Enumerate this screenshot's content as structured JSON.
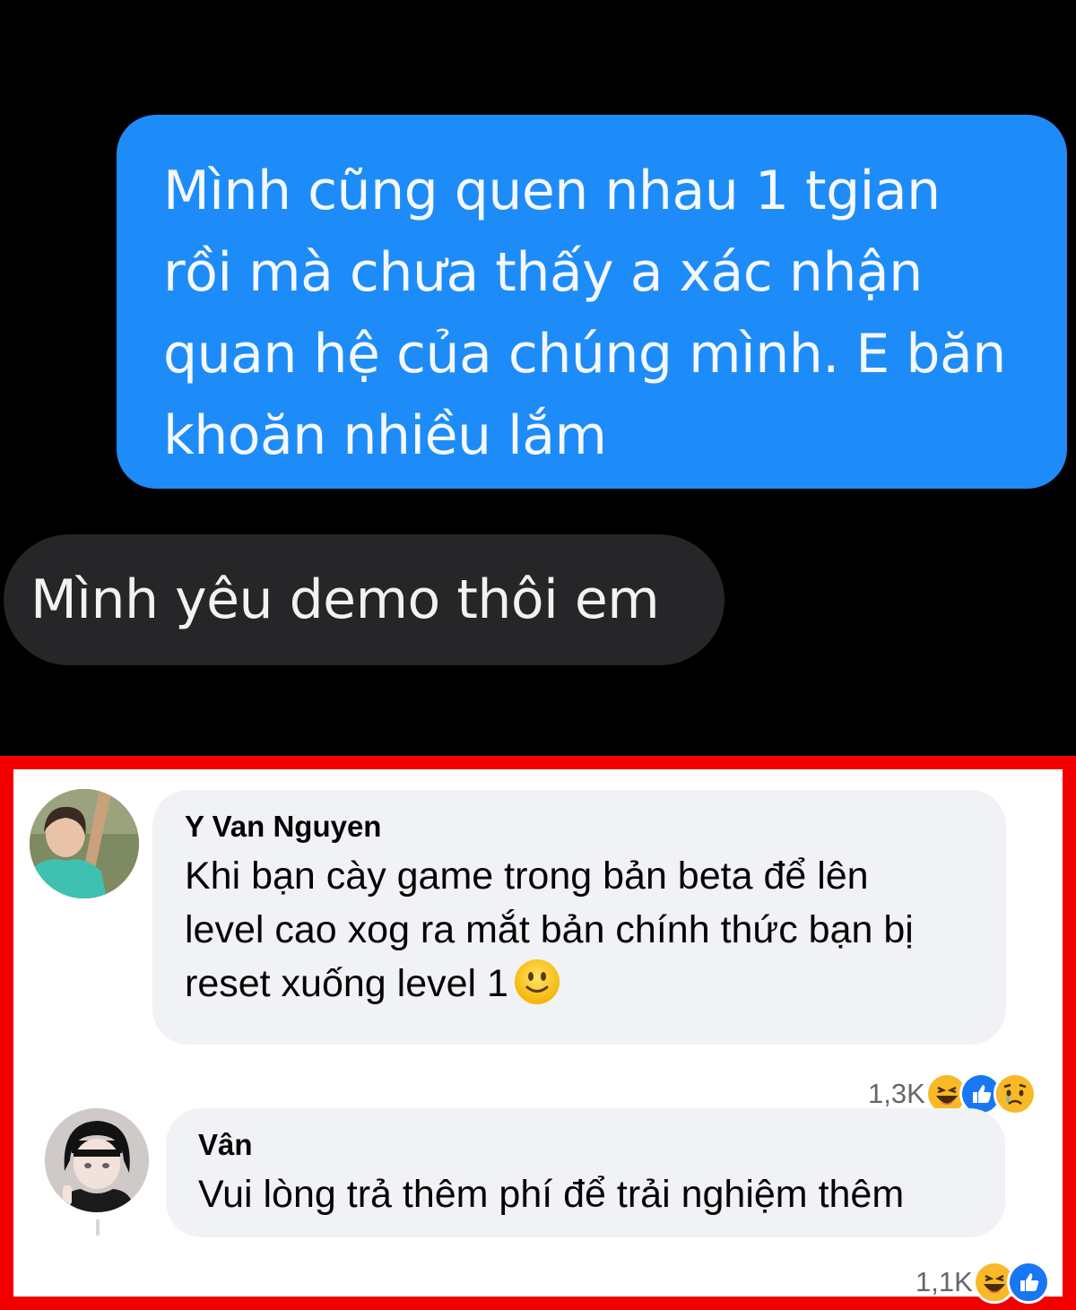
{
  "chat": {
    "sent_message": "Mình cũng quen nhau 1 tgian\nrồi mà chưa thấy a xác nhận\nquan hệ của chúng mình. E băn\nkhoăn nhiều lắm",
    "received_message": "Mình yêu demo thôi em"
  },
  "comments": [
    {
      "author": "Y Van Nguyen",
      "text": "Khi bạn cày game trong bản beta để lên\nlevel cao xog ra mắt bản chính thức bạn bị\nreset xuống level 1",
      "inline_emoji": "slightly-smiling-face",
      "reaction_count": "1,3K",
      "reactions": [
        "laugh",
        "like",
        "sad"
      ]
    },
    {
      "author": "Vân",
      "text": "Vui lòng trả thêm phí để trải nghiệm thêm",
      "reaction_count": "1,1K",
      "reactions": [
        "laugh",
        "like"
      ]
    }
  ],
  "colors": {
    "sent_bubble": "#1d8cf8",
    "received_bubble": "#262628",
    "highlight_border": "#f20000",
    "comment_bubble": "#f0f2f5"
  }
}
